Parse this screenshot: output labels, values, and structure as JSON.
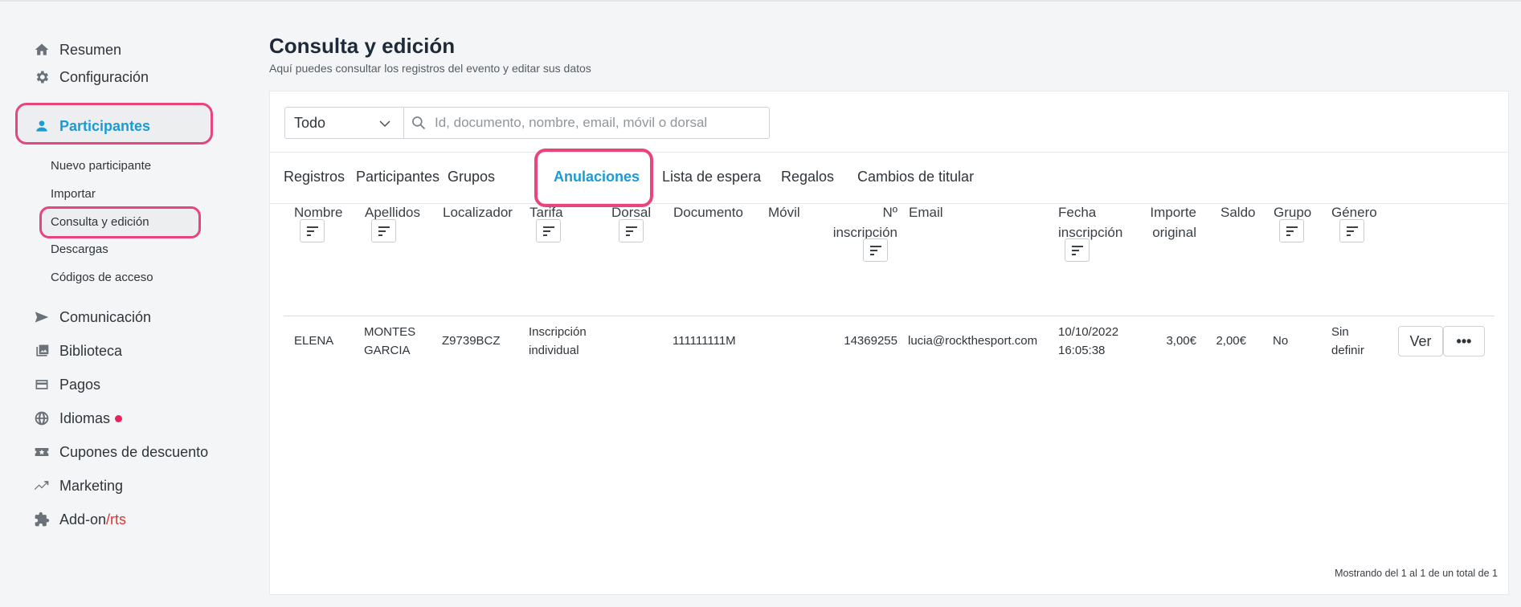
{
  "sidebar": {
    "items": [
      {
        "label": "Resumen",
        "icon": "home-icon"
      },
      {
        "label": "Configuración",
        "icon": "gear-icon"
      },
      {
        "label": "Participantes",
        "icon": "user-icon"
      },
      {
        "label": "Comunicación",
        "icon": "send-icon"
      },
      {
        "label": "Biblioteca",
        "icon": "gallery-icon"
      },
      {
        "label": "Pagos",
        "icon": "credit-card-icon"
      },
      {
        "label": "Idiomas",
        "icon": "globe-icon"
      },
      {
        "label": "Cupones de descuento",
        "icon": "ticket-icon"
      },
      {
        "label": "Marketing",
        "icon": "trend-icon"
      },
      {
        "label": "Add-on",
        "label_suffix": "/rts",
        "icon": "puzzle-icon"
      }
    ],
    "subitems": [
      "Nuevo participante",
      "Importar",
      "Consulta y edición",
      "Descargas",
      "Códigos de acceso"
    ]
  },
  "header": {
    "title": "Consulta y edición",
    "subtitle": "Aquí puedes consultar los registros del evento y editar sus datos"
  },
  "filter": {
    "selected": "Todo",
    "search_placeholder": "Id, documento, nombre, email, móvil o dorsal"
  },
  "tabs": [
    "Registros",
    "Participantes",
    "Grupos",
    "Anulaciones",
    "Lista de espera",
    "Regalos",
    "Cambios de titular"
  ],
  "table": {
    "headers": {
      "nombre": "Nombre",
      "apellidos": "Apellidos",
      "localizador": "Localizador",
      "tarifa": "Tarifa",
      "dorsal": "Dorsal",
      "documento": "Documento",
      "movil": "Móvil",
      "inscripcion_1": "Nº",
      "inscripcion_2": "inscripción",
      "email": "Email",
      "fecha_1": "Fecha",
      "fecha_2": "inscripción",
      "importe_1": "Importe",
      "importe_2": "original",
      "saldo": "Saldo",
      "grupo": "Grupo",
      "genero": "Género"
    },
    "rows": [
      {
        "nombre": "ELENA",
        "apellidos_1": "MONTES",
        "apellidos_2": "GARCIA",
        "localizador": "Z9739BCZ",
        "tarifa_1": "Inscripción",
        "tarifa_2": "individual",
        "dorsal": "",
        "documento": "111111111M",
        "movil": "",
        "inscripcion": "14369255",
        "email": "lucia@rockthesport.com",
        "fecha_1": "10/10/2022",
        "fecha_2": "16:05:38",
        "importe": "3,00€",
        "saldo": "2,00€",
        "grupo": "No",
        "genero_1": "Sin",
        "genero_2": "definir"
      }
    ],
    "view_label": "Ver",
    "more_label": "•••"
  },
  "footer": {
    "info": "Mostrando del 1 al 1 de un total de 1"
  },
  "colors": {
    "accent": "#1a9ad6",
    "highlight": "#e8457a",
    "notification_dot": "#e8245f",
    "rts": "#e83030"
  }
}
